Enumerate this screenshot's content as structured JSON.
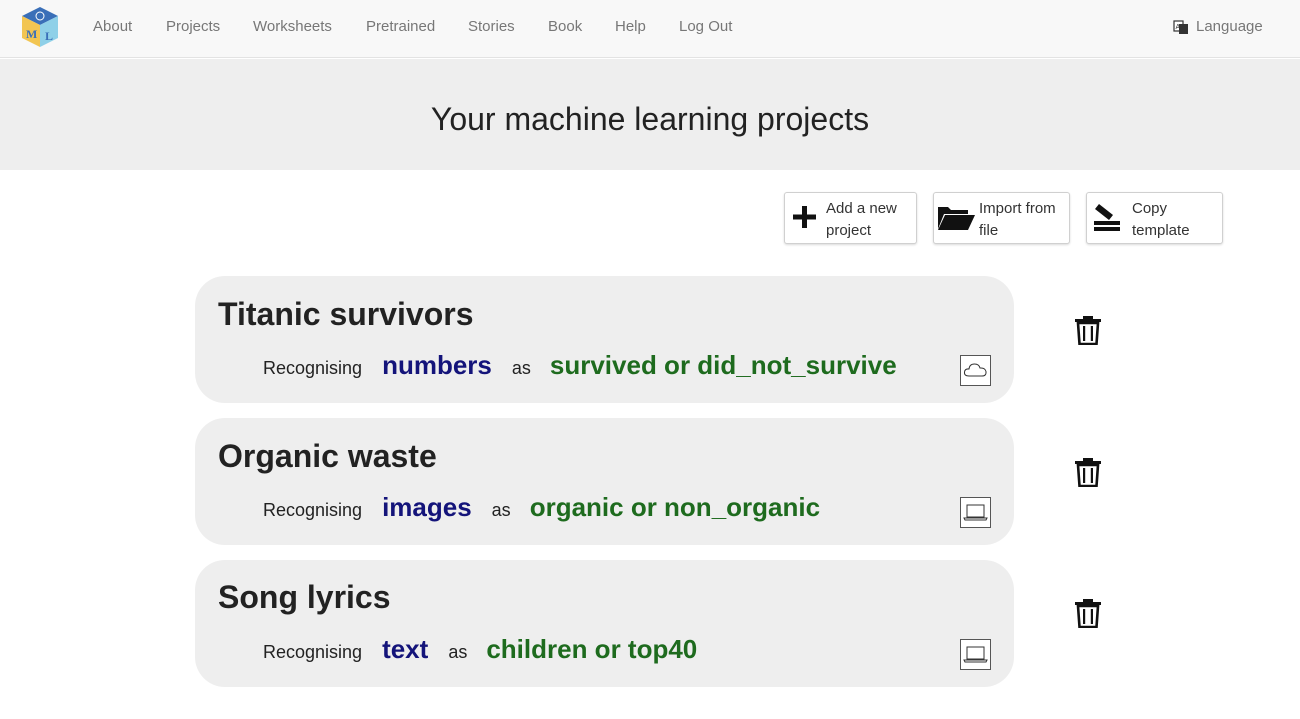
{
  "nav": {
    "items": [
      "About",
      "Projects",
      "Worksheets",
      "Pretrained",
      "Stories",
      "Book",
      "Help",
      "Log Out"
    ],
    "language_label": "Language",
    "logo_letters": [
      "M",
      "L"
    ]
  },
  "header": {
    "title": "Your machine learning projects"
  },
  "actions": [
    {
      "line1": "Add a new",
      "line2": "project",
      "icon": "plus-icon"
    },
    {
      "line1": "Import from",
      "line2": "file",
      "icon": "folder-open-icon"
    },
    {
      "line1": "Copy",
      "line2": "template",
      "icon": "copy-template-icon"
    }
  ],
  "projects": [
    {
      "name": "Titanic survivors",
      "recognising": "Recognising",
      "type": "numbers",
      "as": "as",
      "labels": "survived or did_not_survive",
      "storage": "cloud-icon"
    },
    {
      "name": "Organic waste",
      "recognising": "Recognising",
      "type": "images",
      "as": "as",
      "labels": "organic or non_organic",
      "storage": "laptop-icon"
    },
    {
      "name": "Song lyrics",
      "recognising": "Recognising",
      "type": "text",
      "as": "as",
      "labels": "children or top40",
      "storage": "laptop-icon"
    }
  ],
  "colors": {
    "type_color": "#14147a",
    "label_color": "#1e6b1e",
    "card_bg": "#eeeeee"
  }
}
